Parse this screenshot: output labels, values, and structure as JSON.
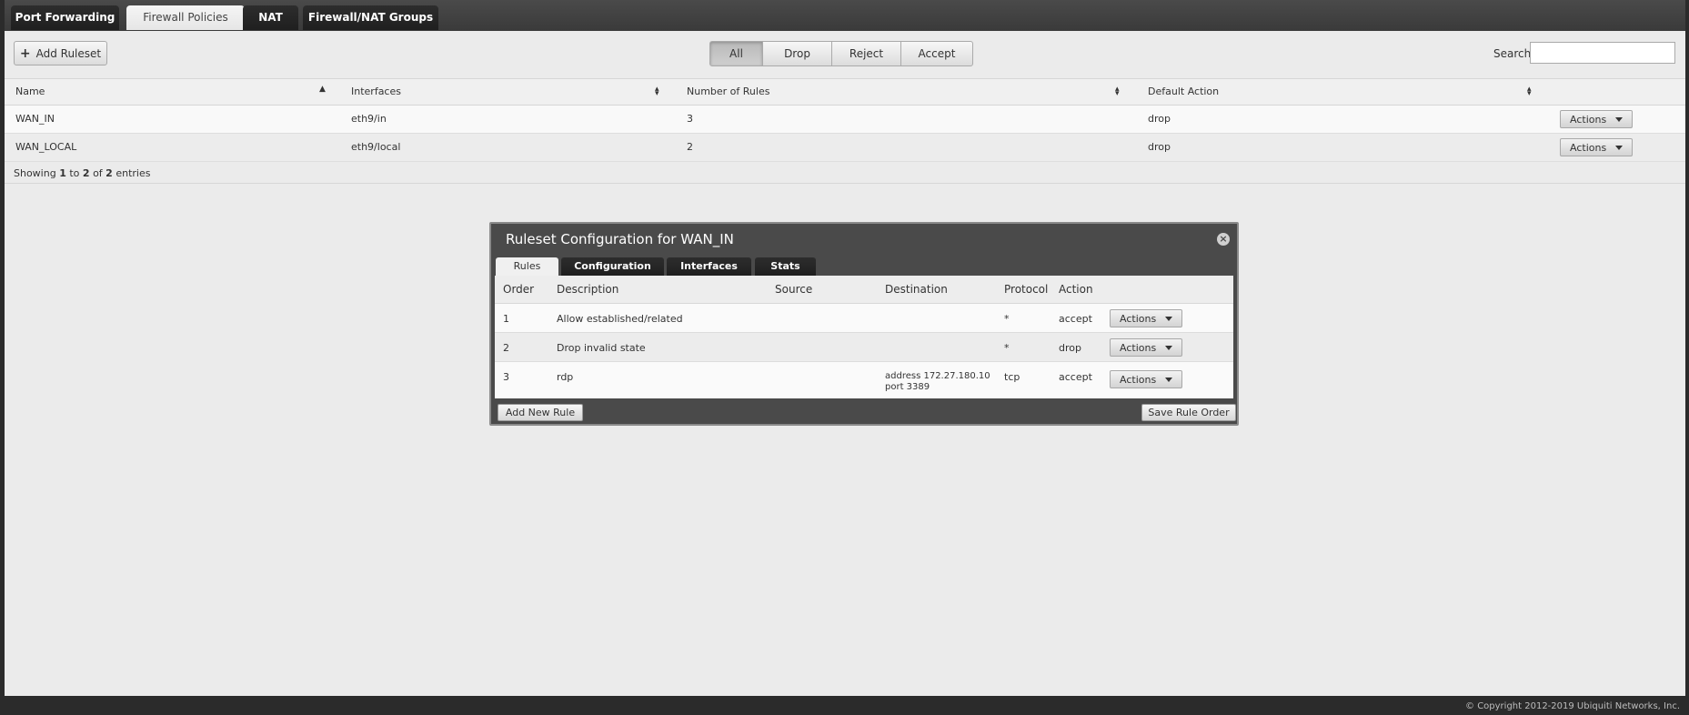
{
  "top_tabs": [
    {
      "label": "Port Forwarding",
      "active": false
    },
    {
      "label": "Firewall Policies",
      "active": true
    },
    {
      "label": "NAT",
      "active": false
    },
    {
      "label": "Firewall/NAT Groups",
      "active": false
    }
  ],
  "toolbar": {
    "add_ruleset_label": "Add Ruleset",
    "filters": [
      "All",
      "Drop",
      "Reject",
      "Accept"
    ],
    "active_filter": "All",
    "search_label": "Search",
    "search_value": ""
  },
  "rulesets_table": {
    "columns": [
      "Name",
      "Interfaces",
      "Number of Rules",
      "Default Action"
    ],
    "rows": [
      {
        "name": "WAN_IN",
        "interfaces": "eth9/in",
        "rules": "3",
        "default_action": "drop",
        "actions_label": "Actions"
      },
      {
        "name": "WAN_LOCAL",
        "interfaces": "eth9/local",
        "rules": "2",
        "default_action": "drop",
        "actions_label": "Actions"
      }
    ],
    "showing": {
      "prefix": "Showing",
      "from": "1",
      "to_word": "to",
      "to": "2",
      "of_word": "of",
      "total": "2",
      "suffix": "entries"
    }
  },
  "dialog": {
    "title": "Ruleset Configuration for WAN_IN",
    "tabs": [
      "Rules",
      "Configuration",
      "Interfaces",
      "Stats"
    ],
    "active_tab": "Rules",
    "columns": [
      "Order",
      "Description",
      "Source",
      "Destination",
      "Protocol",
      "Action"
    ],
    "rows": [
      {
        "order": "1",
        "description": "Allow established/related",
        "source": "",
        "destination_line1": "",
        "destination_line2": "",
        "protocol": "*",
        "action": "accept",
        "actions_label": "Actions"
      },
      {
        "order": "2",
        "description": "Drop invalid state",
        "source": "",
        "destination_line1": "",
        "destination_line2": "",
        "protocol": "*",
        "action": "drop",
        "actions_label": "Actions"
      },
      {
        "order": "3",
        "description": "rdp",
        "source": "",
        "destination_line1": "address 172.27.180.10",
        "destination_line2": "port 3389",
        "protocol": "tcp",
        "action": "accept",
        "actions_label": "Actions"
      }
    ],
    "add_rule_label": "Add New Rule",
    "save_order_label": "Save Rule Order",
    "close_icon": "close-icon"
  },
  "footer": {
    "copyright": "© Copyright 2012-2019 Ubiquiti Networks, Inc."
  }
}
